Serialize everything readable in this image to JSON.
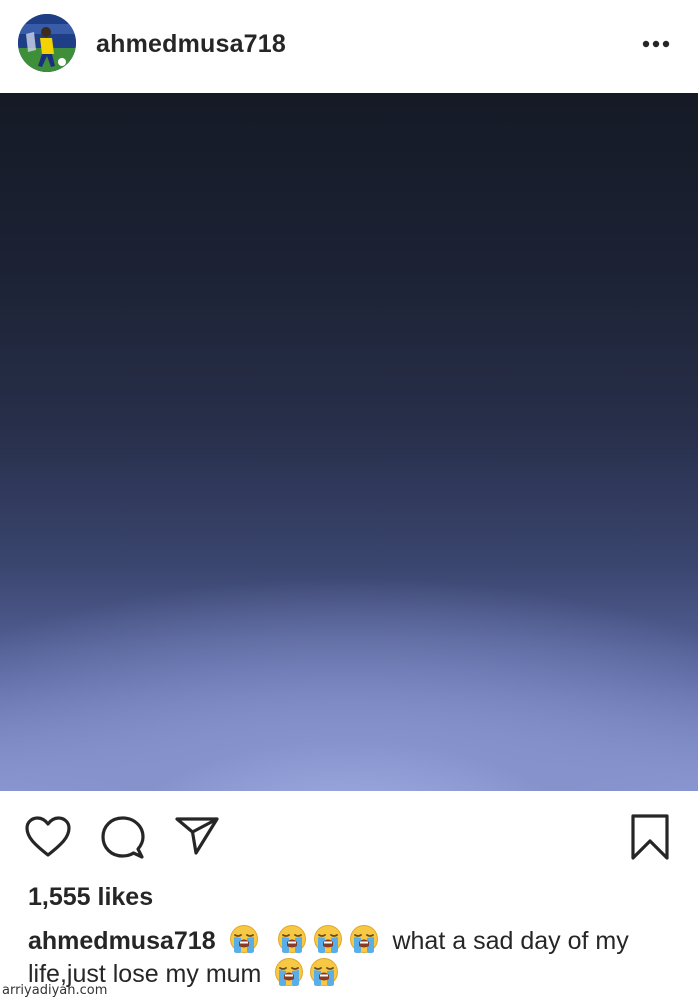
{
  "post": {
    "username": "ahmedmusa718",
    "likes_text": "1,555 likes",
    "caption_user": "ahmedmusa718",
    "caption_text_1": "what a sad day of my",
    "caption_text_2": "life,just lose my mum",
    "emoji_name": "loudly-crying-face"
  },
  "icons": {
    "more": "more-horizontal-icon",
    "like": "heart-icon",
    "comment": "comment-icon",
    "share": "send-icon",
    "save": "bookmark-icon"
  },
  "colors": {
    "text": "#262626",
    "image_top": "#151a26",
    "image_bottom": "#8e9bd6"
  },
  "watermark": "arriyadiyah.com"
}
